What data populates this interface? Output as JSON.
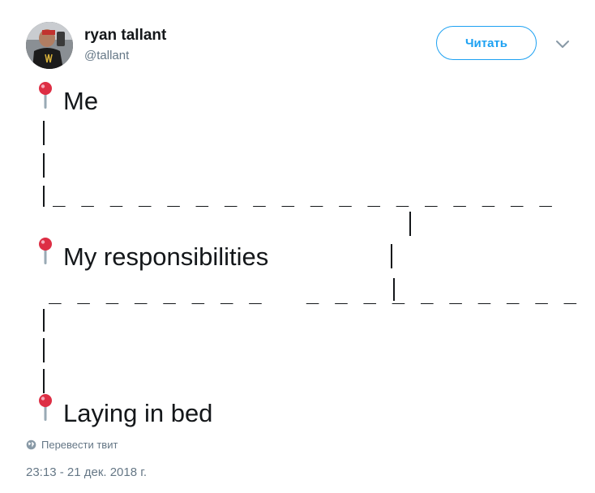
{
  "author": {
    "name": "ryan tallant",
    "handle": "@tallant"
  },
  "follow_button": {
    "label": "Читать"
  },
  "menu": {
    "icon": "chevron-down-icon"
  },
  "tweet": {
    "lines": [
      {
        "icon": "round-pushpin-icon",
        "text": "Me"
      },
      {
        "icon": "round-pushpin-icon",
        "text": "My responsibilities"
      },
      {
        "icon": "round-pushpin-icon",
        "text": "Laying in bed"
      }
    ],
    "bar_glyph": "|",
    "dash_row_1": "_ _ _ _ _ _ _ _ _ _ _ _ _ _ _ _ _ _",
    "dash_row_2": "_ _ _ _ _ _ _ _   _ _ _ _ _ _ _ _ _ _"
  },
  "translate_link": {
    "icon": "globe-icon",
    "label": "Перевести твит"
  },
  "timestamp": "23:13 - 21 дек. 2018 г.",
  "colors": {
    "accent": "#1da1f2",
    "muted": "#657786",
    "text": "#14171a",
    "pin_red": "#dd2e44"
  }
}
